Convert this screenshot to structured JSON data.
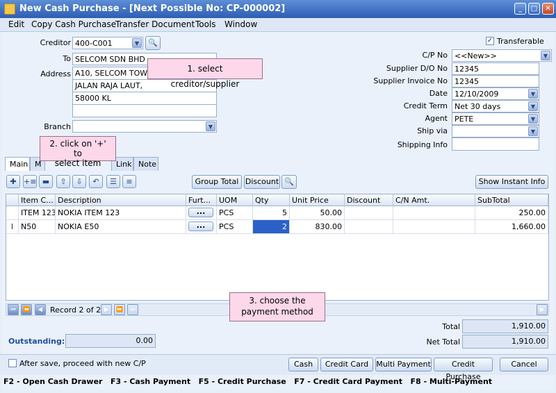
{
  "window": {
    "title": "New Cash Purchase - [Next Possible No: CP-000002]"
  },
  "menu": [
    "Edit",
    "Copy Cash Purchase",
    "Transfer Document",
    "Tools",
    "Window"
  ],
  "header": {
    "creditor_label": "Creditor",
    "creditor_value": "400-C001",
    "to_label": "To",
    "to_value": "SELCOM SDN BHD",
    "address_label": "Address",
    "address_lines": [
      "A10, SELCOM TOWER,",
      "JALAN RAJA LAUT,",
      "58000 KL",
      ""
    ],
    "branch_label": "Branch",
    "branch_value": ""
  },
  "transferable": {
    "label": "Transferable",
    "checked": true
  },
  "right_fields": {
    "cp_no_label": "C/P  No",
    "cp_no_value": "<<New>>",
    "supplier_do_label": "Supplier D/O No",
    "supplier_do_value": "12345",
    "supplier_inv_label": "Supplier Invoice No",
    "supplier_inv_value": "12345",
    "date_label": "Date",
    "date_value": "12/10/2009",
    "credit_term_label": "Credit Term",
    "credit_term_value": "Net 30 days",
    "agent_label": "Agent",
    "agent_value": "PETE",
    "ship_via_label": "Ship via",
    "ship_via_value": "",
    "shipping_info_label": "Shipping Info",
    "shipping_info_value": ""
  },
  "callouts": {
    "c1": "1. select creditor/supplier",
    "c2_line1": "2. click on '+' to",
    "c2_line2": "select item",
    "c3_line1": "3. choose the",
    "c3_line2": "payment method"
  },
  "tabs": [
    "Main",
    "M",
    "Link",
    "Note"
  ],
  "toolbar": {
    "group_total": "Group Total",
    "discount": "Discount",
    "show_instant_info": "Show Instant Info"
  },
  "grid": {
    "columns": [
      "Item C...",
      "Description",
      "Furt...",
      "UOM",
      "Qty",
      "Unit Price",
      "Discount",
      "C/N Amt.",
      "SubTotal"
    ],
    "rows": [
      {
        "item": "ITEM 123",
        "desc": "NOKIA ITEM 123",
        "further": "...",
        "uom": "PCS",
        "qty": "5",
        "price": "50.00",
        "discount": "",
        "cn": "",
        "subtotal": "250.00"
      },
      {
        "item": "N50",
        "desc": "NOKIA E50",
        "further": "...",
        "uom": "PCS",
        "qty": "2",
        "price": "830.00",
        "discount": "",
        "cn": "",
        "subtotal": "1,660.00"
      }
    ],
    "record_text": "Record 2 of 2"
  },
  "totals": {
    "total_label": "Total",
    "total_value": "1,910.00",
    "net_total_label": "Net Total",
    "net_total_value": "1,910.00",
    "outstanding_label": "Outstanding:",
    "outstanding_value": "0.00"
  },
  "footer": {
    "after_save_label": "After save, proceed with new C/P",
    "cash": "Cash",
    "credit_card": "Credit Card",
    "multi_payment": "Multi Payment",
    "credit_purchase": "Credit Purchase",
    "cancel": "Cancel"
  },
  "hotkeys": "F2 - Open Cash Drawer   F3 - Cash Payment   F5 - Credit Purchase   F7 - Credit Card Payment   F8 - Multi-Payment",
  "colors": {
    "title_bar": "#2c5db4",
    "callout": "#fdd7ea",
    "outstanding_label": "#1f4fa3"
  }
}
